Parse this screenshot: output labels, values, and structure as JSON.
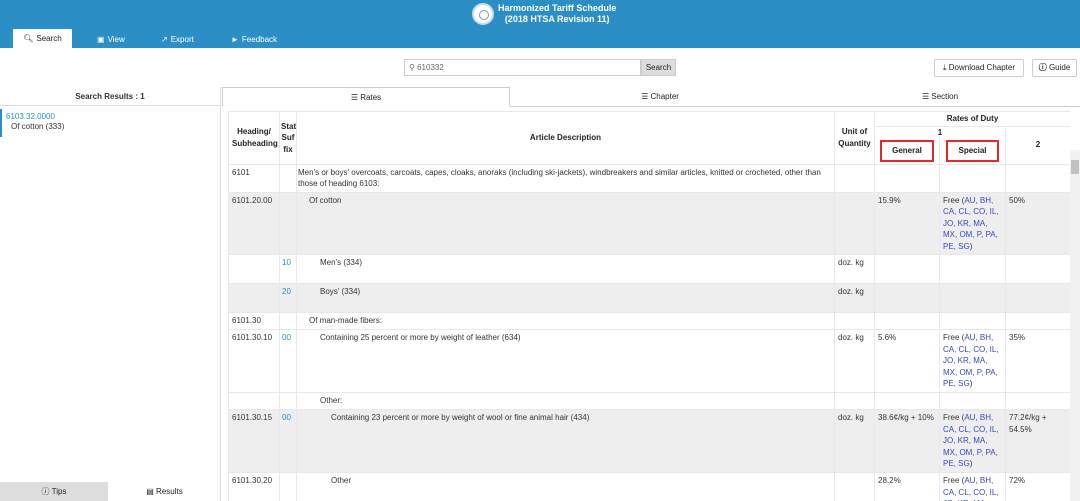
{
  "header": {
    "title1": "Harmonized Tariff Schedule",
    "title2": "(2018 HTSA Revision 11)"
  },
  "nav": {
    "search": "Search",
    "view": "View",
    "export": "Export",
    "feedback": "Feedback"
  },
  "search": {
    "value": "610332",
    "button": "Search"
  },
  "buttons": {
    "download": "Download Chapter",
    "guide": "Guide"
  },
  "left": {
    "results_label": "Search Results : 1",
    "item_code": "6103.32.0000",
    "item_desc": "Of cotton (333)",
    "tips": "Tips",
    "results": "Results"
  },
  "tabs": {
    "rates": "Rates",
    "chapter": "Chapter",
    "section": "Section"
  },
  "table": {
    "h_heading": "Heading/ Subheading",
    "h_stat": "Stat Suf fix",
    "h_article": "Article Description",
    "h_unit": "Unit of Quantity",
    "h_rates": "Rates of Duty",
    "h_col1": "1",
    "h_general": "General",
    "h_special": "Special",
    "h_col2": "2",
    "rows": [
      {
        "heading": "6101",
        "stat": "",
        "desc": "Men's or boys' overcoats, carcoats, capes, cloaks, anoraks (including ski-jackets), windbreakers and similar articles, knitted or crocheted, other than those of heading 6103:",
        "unit": "",
        "general": "",
        "special_pre": "",
        "special_links": "",
        "special_post": "",
        "col2": ""
      },
      {
        "heading": "6101.20.00",
        "stat": "",
        "desc": "Of cotton",
        "unit": "",
        "general": "15.9%",
        "special_pre": "Free (",
        "special_links": "AU, BH, CA, CL, CO, IL, JO, KR, MA, MX, OM, P, PA, PE, SG",
        "special_post": ")",
        "col2": "50%"
      },
      {
        "heading": "",
        "stat": "10",
        "desc": "Men's (334)",
        "unit": "doz. kg",
        "general": "",
        "special_pre": "",
        "special_links": "",
        "special_post": "",
        "col2": ""
      },
      {
        "heading": "",
        "stat": "20",
        "desc": "Boys' (334)",
        "unit": "doz. kg",
        "general": "",
        "special_pre": "",
        "special_links": "",
        "special_post": "",
        "col2": ""
      },
      {
        "heading": "6101.30",
        "stat": "",
        "desc": "Of man-made fibers:",
        "unit": "",
        "general": "",
        "special_pre": "",
        "special_links": "",
        "special_post": "",
        "col2": ""
      },
      {
        "heading": "6101.30.10",
        "stat": "00",
        "desc": "Containing 25 percent or more by weight of leather (634)",
        "unit": "doz. kg",
        "general": "5.6%",
        "special_pre": "Free (",
        "special_links": "AU, BH, CA, CL, CO, IL, JO, KR, MA, MX, OM, P, PA, PE, SG",
        "special_post": ")",
        "col2": "35%"
      },
      {
        "heading": "",
        "stat": "",
        "desc": "Other:",
        "unit": "",
        "general": "",
        "special_pre": "",
        "special_links": "",
        "special_post": "",
        "col2": ""
      },
      {
        "heading": "6101.30.15",
        "stat": "00",
        "desc": "Containing 23 percent or more by weight of wool or fine animal hair (434)",
        "unit": "doz. kg",
        "general": "38.6¢/kg + 10%",
        "special_pre": "Free (",
        "special_links": "AU, BH, CA, CL, CO, IL, JO, KR, MA, MX, OM, P, PA, PE, SG",
        "special_post": ")",
        "col2": "77.2¢/kg + 54.5%"
      },
      {
        "heading": "6101.30.20",
        "stat": "",
        "desc": "Other",
        "unit": "",
        "general": "28.2%",
        "special_pre": "Free (",
        "special_links": "AU, BH, CA, CL, CO, IL, JO, KR, MA, MX,",
        "special_post": "",
        "col2": "72%"
      }
    ]
  }
}
